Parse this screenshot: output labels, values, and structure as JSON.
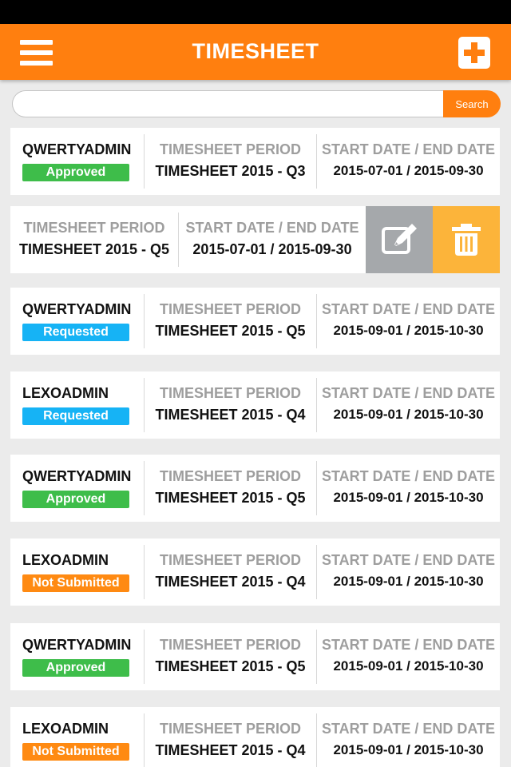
{
  "header": {
    "title": "TIMESHEET",
    "menu_icon": "hamburger-menu-icon",
    "add_icon": "plus-square-icon"
  },
  "search": {
    "placeholder": "",
    "button_label": "Search"
  },
  "labels": {
    "period": "TIMESHEET PERIOD",
    "dates": "START DATE / END DATE"
  },
  "colors": {
    "accent": "#ff7f0f",
    "approved": "#3ebd4a",
    "requested": "#16b3f5",
    "not_submitted": "#ff8a12",
    "edit": "#a5a8ab",
    "delete": "#fcb43a"
  },
  "cards": [
    {
      "user": "QWERTYADMIN",
      "status": "Approved",
      "status_color": "#3ebd4a",
      "period": "TIMESHEET 2015 - Q3",
      "dates": "2015-07-01 / 2015-09-30"
    },
    {
      "user": "",
      "status": "",
      "status_color": "",
      "period": "TIMESHEET 2015 - Q5",
      "dates": "2015-07-01 / 2015-09-30",
      "swiped": true,
      "edit_icon": "edit-icon",
      "delete_icon": "trash-icon"
    },
    {
      "user": "QWERTYADMIN",
      "status": "Requested",
      "status_color": "#16b3f5",
      "period": "TIMESHEET 2015 - Q5",
      "dates": "2015-09-01 / 2015-10-30"
    },
    {
      "user": "LEXOADMIN",
      "status": "Requested",
      "status_color": "#16b3f5",
      "period": "TIMESHEET 2015 - Q4",
      "dates": "2015-09-01 / 2015-10-30"
    },
    {
      "user": "QWERTYADMIN",
      "status": "Approved",
      "status_color": "#3ebd4a",
      "period": "TIMESHEET 2015 - Q5",
      "dates": "2015-09-01 / 2015-10-30"
    },
    {
      "user": "LEXOADMIN",
      "status": "Not Submitted",
      "status_color": "#ff8a12",
      "period": "TIMESHEET 2015 - Q4",
      "dates": "2015-09-01 / 2015-10-30"
    },
    {
      "user": "QWERTYADMIN",
      "status": "Approved",
      "status_color": "#3ebd4a",
      "period": "TIMESHEET 2015 - Q5",
      "dates": "2015-09-01 / 2015-10-30"
    },
    {
      "user": "LEXOADMIN",
      "status": "Not Submitted",
      "status_color": "#ff8a12",
      "period": "TIMESHEET 2015 - Q4",
      "dates": "2015-09-01 / 2015-10-30"
    }
  ]
}
